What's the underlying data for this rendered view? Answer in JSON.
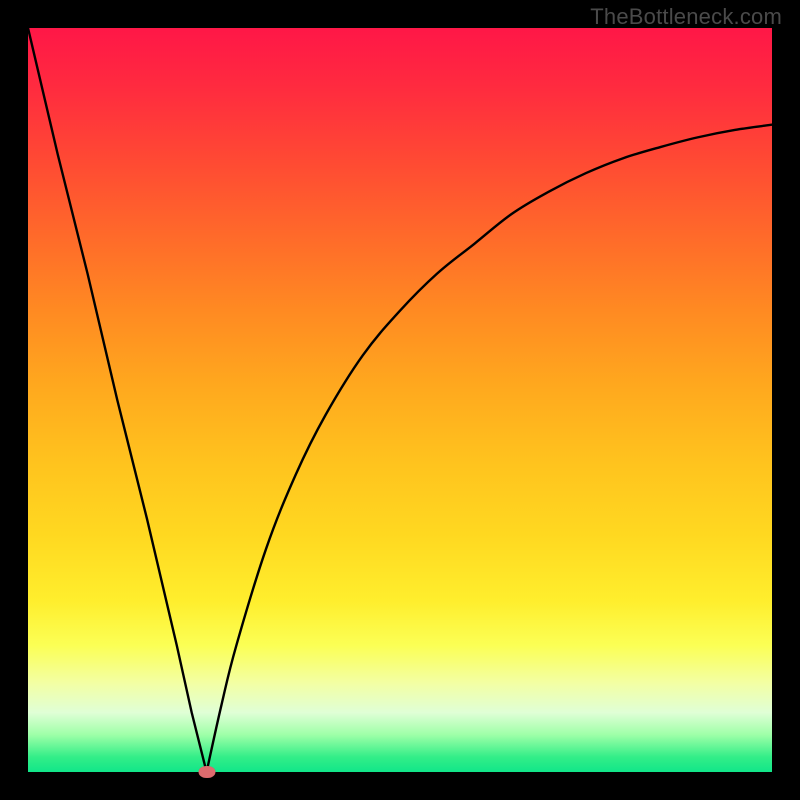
{
  "watermark": "TheBottleneck.com",
  "colors": {
    "background": "#000000",
    "curve": "#000000",
    "marker": "#dd6b6e"
  },
  "chart_data": {
    "type": "line",
    "title": "",
    "xlabel": "",
    "ylabel": "",
    "xlim": [
      0,
      100
    ],
    "ylim": [
      0,
      100
    ],
    "grid": false,
    "legend": false,
    "notes": "Bottleneck-style curve: steep linear descent from top-left to a minimum near x≈24, then a concave rise toward the upper-right. A small pink marker sits at the minimum on the x-axis.",
    "min_x": 24,
    "marker": {
      "x": 24,
      "y": 0
    },
    "series": [
      {
        "name": "curve",
        "x": [
          0,
          4,
          8,
          12,
          16,
          20,
          22,
          24,
          26,
          28,
          32,
          36,
          40,
          45,
          50,
          55,
          60,
          65,
          70,
          75,
          80,
          85,
          90,
          95,
          100
        ],
        "y": [
          100,
          83,
          67,
          50,
          34,
          17,
          8,
          0,
          9,
          17,
          30,
          40,
          48,
          56,
          62,
          67,
          71,
          75,
          78,
          80.5,
          82.5,
          84,
          85.3,
          86.3,
          87
        ]
      }
    ]
  }
}
